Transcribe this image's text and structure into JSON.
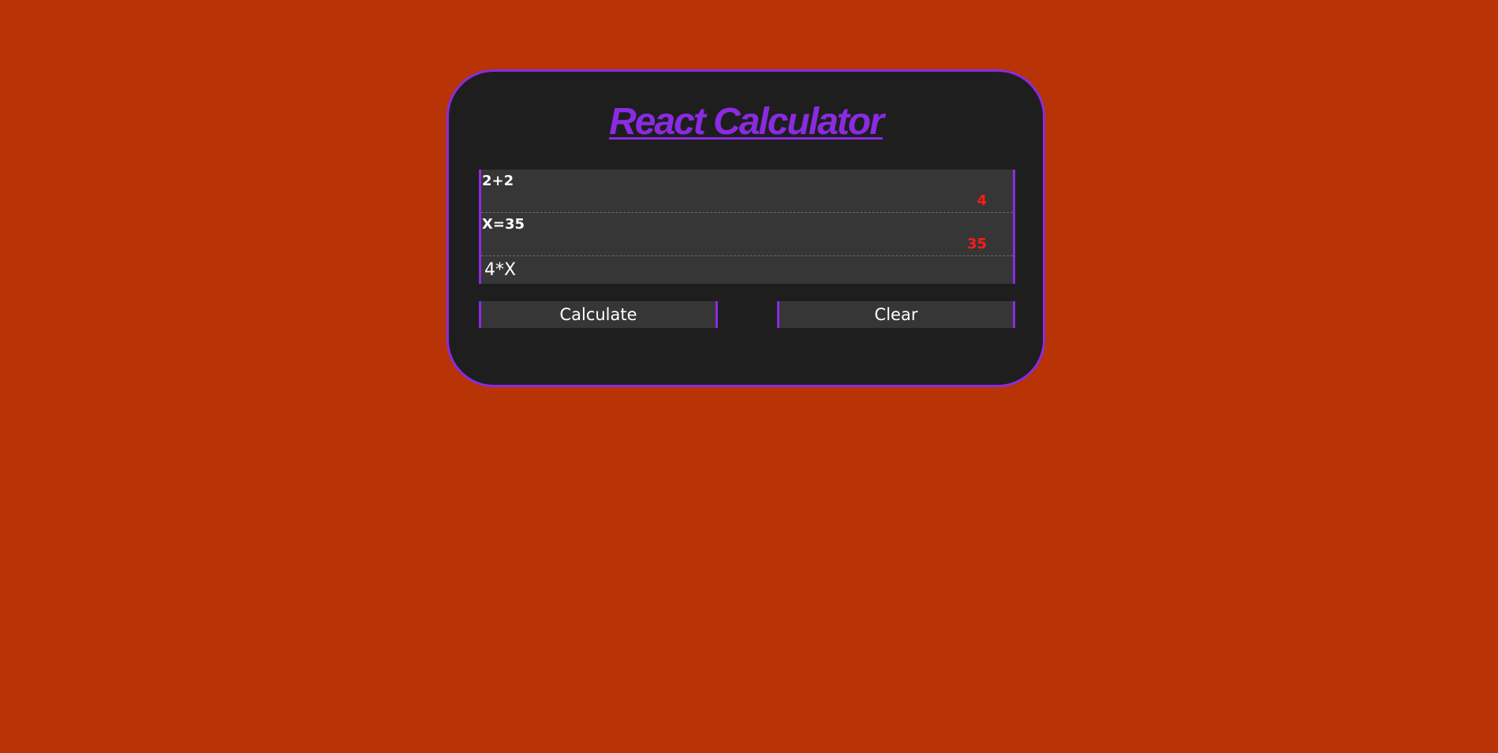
{
  "app": {
    "title": "React Calculator"
  },
  "history": [
    {
      "expression": "2+2",
      "result": "4"
    },
    {
      "expression": "X=35",
      "result": "35"
    }
  ],
  "input": {
    "value": "4*X"
  },
  "buttons": {
    "calculate_label": "Calculate",
    "clear_label": "Clear"
  },
  "colors": {
    "background": "#b83306",
    "card": "#1e1e1e",
    "accent": "#8a2be2",
    "result": "#ff1a1a",
    "display": "#363636"
  }
}
